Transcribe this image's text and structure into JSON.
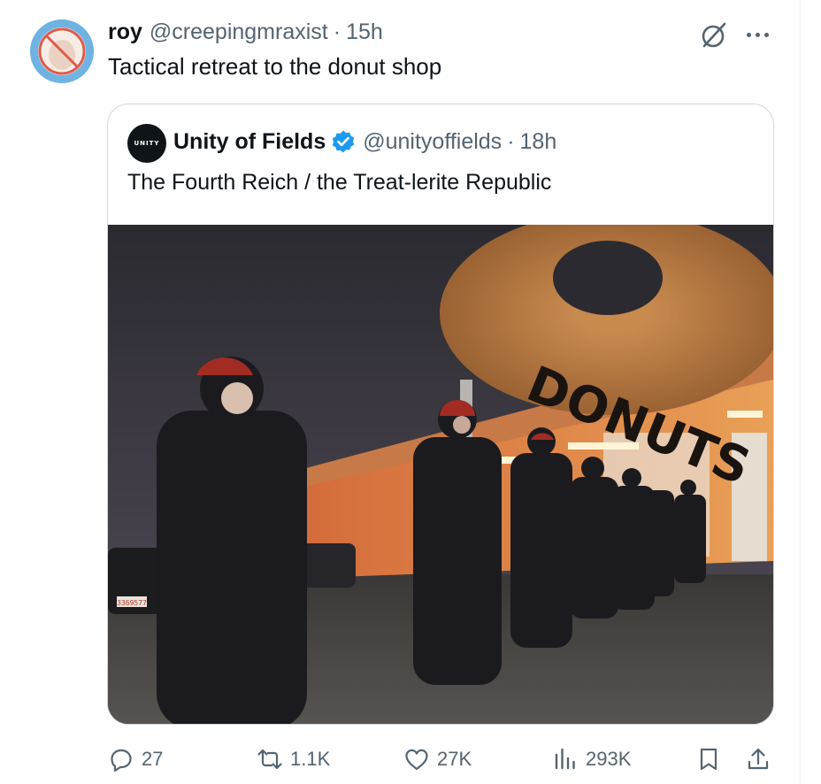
{
  "tweet": {
    "author_name": "roy",
    "author_handle": "@creepingmraxist",
    "separator": "·",
    "time": "15h",
    "text": "Tactical retreat to the donut shop"
  },
  "quoted_tweet": {
    "avatar_text": "UNITY",
    "author_name": "Unity of Fields",
    "author_handle": "@unityoffields",
    "separator": "·",
    "time": "18h",
    "text": "The Fourth Reich / the Treat-lerite Republic",
    "media": {
      "sign_text": "DONUTS",
      "license_plate": "3369577"
    }
  },
  "actions": {
    "replies": "27",
    "reposts": "1.1K",
    "likes": "27K",
    "views": "293K"
  },
  "icons": [
    "grok-icon",
    "more-icon",
    "verified-icon",
    "reply-icon",
    "repost-icon",
    "like-icon",
    "views-icon",
    "bookmark-icon",
    "share-icon"
  ],
  "colors": {
    "text_primary": "#0f1419",
    "text_secondary": "#536471",
    "border": "#cfd9de",
    "verified": "#1d9bf0",
    "avatar_bg": "#6fb3e3"
  }
}
